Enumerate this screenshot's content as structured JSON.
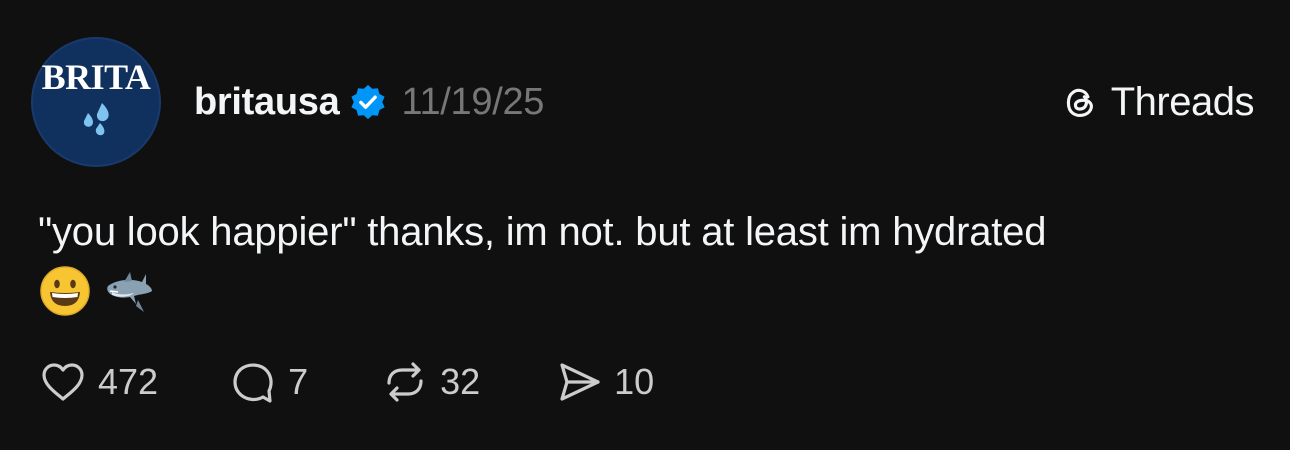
{
  "avatar": {
    "logo_text": "BRITA",
    "background": "#10305e",
    "drop_color": "#7fc4f0"
  },
  "post": {
    "username": "britausa",
    "verified": true,
    "verified_color": "#0095f6",
    "date": "11/19/25",
    "text": "\"you look happier\" thanks, im not. but at least im hydrated",
    "emojis": [
      "grinning-face-emoji",
      "shark-emoji"
    ]
  },
  "brand": {
    "label": "Threads",
    "icon": "threads-icon"
  },
  "actions": {
    "likes": "472",
    "replies": "7",
    "reposts": "32",
    "shares": "10"
  }
}
